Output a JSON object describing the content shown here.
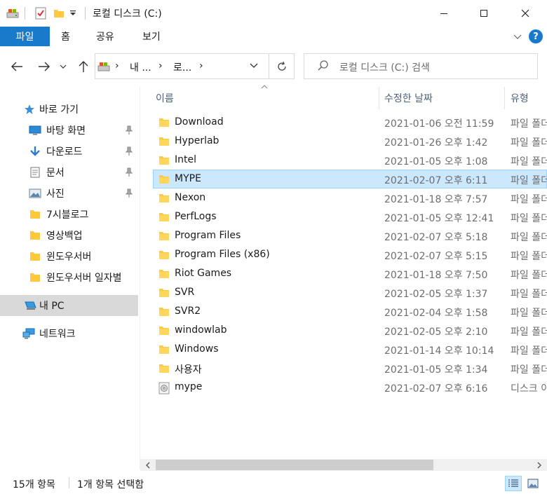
{
  "window": {
    "title": "로컬 디스크 (C:)",
    "minimize_icon": "minimize-icon",
    "maximize_icon": "maximize-icon",
    "close_icon": "close-icon"
  },
  "ribbon": {
    "tabs": [
      "파일",
      "홈",
      "공유",
      "보기"
    ],
    "help_label": "?"
  },
  "address": {
    "crumbs": [
      "내 ...",
      "로..."
    ],
    "search_placeholder": "로컬 디스크 (C:) 검색"
  },
  "sidebar": {
    "items": [
      {
        "label": "바로 가기",
        "icon": "star-icon"
      },
      {
        "label": "바탕 화면",
        "icon": "desktop-icon",
        "pinned": true
      },
      {
        "label": "다운로드",
        "icon": "download-arrow-icon",
        "pinned": true
      },
      {
        "label": "문서",
        "icon": "document-icon",
        "pinned": true
      },
      {
        "label": "사진",
        "icon": "picture-icon",
        "pinned": true
      },
      {
        "label": "7시블로그",
        "icon": "folder-icon"
      },
      {
        "label": "영상백업",
        "icon": "folder-icon"
      },
      {
        "label": "윈도우서버",
        "icon": "folder-icon"
      },
      {
        "label": "윈도우서버 일자별",
        "icon": "folder-icon"
      },
      {
        "label": "내 PC",
        "icon": "pc-icon",
        "selected": true
      },
      {
        "label": "네트워크",
        "icon": "network-icon"
      }
    ]
  },
  "columns": {
    "name": "이름",
    "date": "수정한 날짜",
    "type": "유형"
  },
  "files": [
    {
      "name": "Download",
      "date": "2021-01-06 오전 11:59",
      "type": "파일 폴더",
      "icon": "folder-icon"
    },
    {
      "name": "Hyperlab",
      "date": "2021-01-26 오후 1:42",
      "type": "파일 폴더",
      "icon": "folder-icon"
    },
    {
      "name": "Intel",
      "date": "2021-01-05 오후 1:08",
      "type": "파일 폴더",
      "icon": "folder-icon"
    },
    {
      "name": "MYPE",
      "date": "2021-02-07 오후 6:11",
      "type": "파일 폴더",
      "icon": "folder-icon",
      "selected": true
    },
    {
      "name": "Nexon",
      "date": "2021-01-18 오후 7:57",
      "type": "파일 폴더",
      "icon": "folder-icon"
    },
    {
      "name": "PerfLogs",
      "date": "2021-01-05 오후 12:41",
      "type": "파일 폴더",
      "icon": "folder-icon"
    },
    {
      "name": "Program Files",
      "date": "2021-02-07 오후 5:18",
      "type": "파일 폴더",
      "icon": "folder-icon"
    },
    {
      "name": "Program Files (x86)",
      "date": "2021-02-07 오후 5:15",
      "type": "파일 폴더",
      "icon": "folder-icon"
    },
    {
      "name": "Riot Games",
      "date": "2021-01-18 오후 7:50",
      "type": "파일 폴더",
      "icon": "folder-icon"
    },
    {
      "name": "SVR",
      "date": "2021-02-05 오후 1:37",
      "type": "파일 폴더",
      "icon": "folder-icon"
    },
    {
      "name": "SVR2",
      "date": "2021-02-04 오후 1:58",
      "type": "파일 폴더",
      "icon": "folder-icon"
    },
    {
      "name": "windowlab",
      "date": "2021-02-05 오후 2:10",
      "type": "파일 폴더",
      "icon": "folder-icon"
    },
    {
      "name": "Windows",
      "date": "2021-01-14 오후 10:14",
      "type": "파일 폴더",
      "icon": "folder-icon"
    },
    {
      "name": "사용자",
      "date": "2021-01-05 오후 1:34",
      "type": "파일 폴더",
      "icon": "folder-icon"
    },
    {
      "name": "mype",
      "date": "2021-02-07 오후 6:16",
      "type": "디스크 이미지 파일",
      "icon": "disc-image-icon"
    }
  ],
  "status": {
    "item_count": "15개 항목",
    "selected_count": "1개 항목 선택함"
  },
  "colors": {
    "accent": "#1979ca",
    "selection_bg": "#cce8ff",
    "selection_border": "#99d1ff",
    "folder": "#ffc83d"
  }
}
